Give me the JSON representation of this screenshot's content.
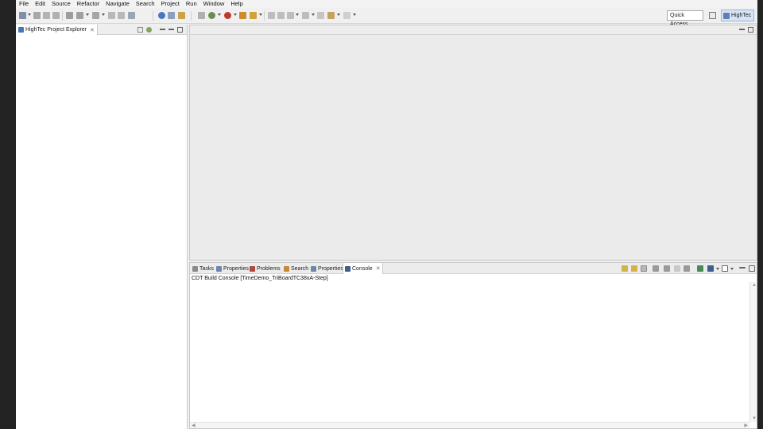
{
  "menu": [
    "File",
    "Edit",
    "Source",
    "Refactor",
    "Navigate",
    "Search",
    "Project",
    "Run",
    "Window",
    "Help"
  ],
  "toolbar": {
    "quick_access": "Quick Access",
    "perspective_label": "HighTec",
    "icons": [
      "new-file-icon",
      "save-icon",
      "save-all-icon",
      "print-icon",
      "build-icon",
      "build-all-icon",
      "clean-icon",
      "help-icon",
      "mail-icon",
      "package-icon",
      "new-project-icon",
      "debug-icon",
      "run-icon",
      "external-tools-icon",
      "tasks-icon",
      "next-annotation-icon",
      "prev-annotation-icon",
      "back-icon",
      "forward-icon"
    ]
  },
  "explorer": {
    "tab_label": "HighTec Project Explorer"
  },
  "console": {
    "tabs": [
      "Tasks",
      "Properties",
      "Problems",
      "Search",
      "Properties",
      "Console"
    ],
    "active_tab": "Console",
    "title": "CDT Build Console [TimeDemo_TriBoardTC38xA-Step]"
  }
}
